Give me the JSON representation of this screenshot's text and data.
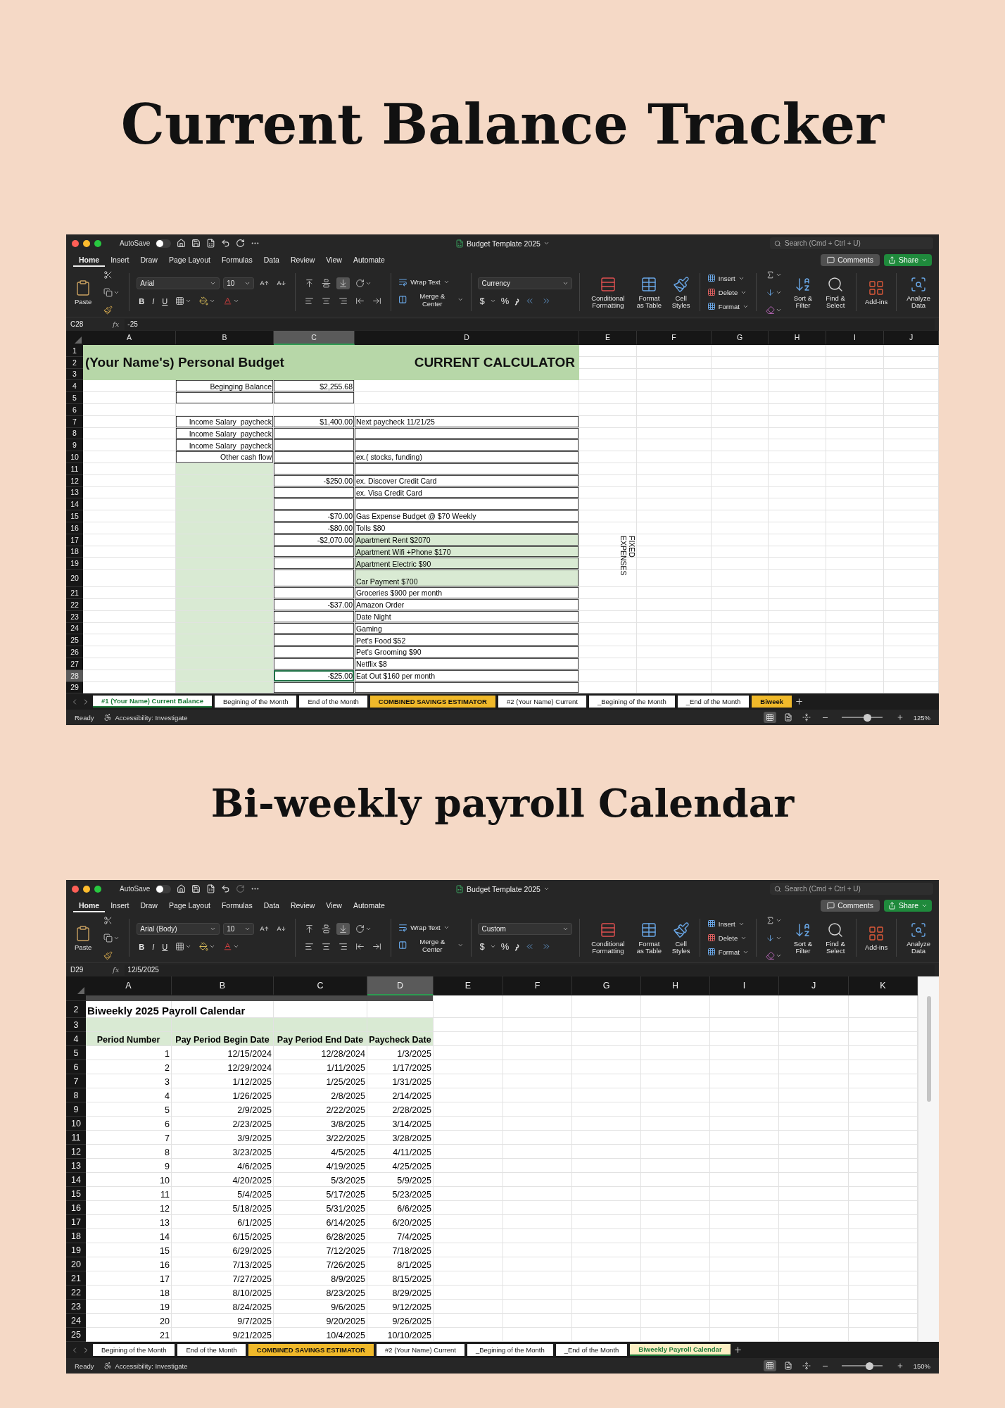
{
  "sections": [
    {
      "heading": "Current Balance Tracker",
      "window": {
        "title": "Budget Template 2025",
        "autosave": {
          "label": "AutoSave",
          "on": false
        },
        "redo": {
          "disabled": false
        },
        "search_placeholder": "Search (Cmd + Ctrl + U)",
        "menu_tabs": [
          {
            "label": "Home",
            "selected": true
          },
          {
            "label": "Insert",
            "selected": false
          },
          {
            "label": "Draw",
            "selected": false
          },
          {
            "label": "Page Layout",
            "selected": false
          },
          {
            "label": "Formulas",
            "selected": false
          },
          {
            "label": "Data",
            "selected": false
          },
          {
            "label": "Review",
            "selected": false
          },
          {
            "label": "View",
            "selected": false
          },
          {
            "label": "Automate",
            "selected": false
          }
        ],
        "comments": "Comments",
        "share": "Share",
        "ribbon": {
          "paste": "Paste",
          "font": "Arial",
          "font_size": "10",
          "bold": "B",
          "italic": "I",
          "underline": "U",
          "vertical_align": [
            {
              "kind": "top",
              "selected": false
            },
            {
              "kind": "middle",
              "selected": false
            },
            {
              "kind": "bottom",
              "selected": true
            }
          ],
          "wrap_text": "Wrap Text",
          "merge": "Merge & Center",
          "number_format": "Currency",
          "currency": "$",
          "percent": "%",
          "conditional_formatting": "Conditional Formatting",
          "format_as_table": "Format as Table",
          "cell_styles": "Cell Styles",
          "insert": "Insert",
          "delete": "Delete",
          "format": "Format",
          "sort_filter": "Sort & Filter",
          "find_select": "Find & Select",
          "add_ins": "Add-ins",
          "analyze_data": "Analyze Data"
        },
        "formula_bar": {
          "name_box": "C28",
          "fx": "fx",
          "formula": "-25"
        },
        "sheet": {
          "hidden_first_row": false,
          "banner": {
            "left": "(Your Name's) Personal Budget",
            "right": "CURRENT CALCULATOR"
          },
          "columns": [
            {
              "label": "A",
              "selected": false
            },
            {
              "label": "B",
              "selected": false
            },
            {
              "label": "C",
              "selected": true
            },
            {
              "label": "D",
              "selected": false
            },
            {
              "label": "E",
              "selected": false
            },
            {
              "label": "F",
              "selected": false
            },
            {
              "label": "G",
              "selected": false
            },
            {
              "label": "H",
              "selected": false
            },
            {
              "label": "I",
              "selected": false
            },
            {
              "label": "J",
              "selected": false
            }
          ],
          "rows": [
            {
              "number": "1",
              "selected": false,
              "cells": {}
            },
            {
              "number": "2",
              "selected": false,
              "cells": {}
            },
            {
              "number": "3",
              "selected": false,
              "cells": {}
            },
            {
              "number": "4",
              "selected": false,
              "cells": {
                "B": "Beginging Balance",
                "C": "$2,255.68"
              }
            },
            {
              "number": "5",
              "selected": false,
              "cells": {}
            },
            {
              "number": "6",
              "selected": false,
              "cells": {}
            },
            {
              "number": "7",
              "selected": false,
              "cells": {
                "B": "Income Salary  paycheck",
                "C": "$1,400.00",
                "D": "Next paycheck 11/21/25"
              }
            },
            {
              "number": "8",
              "selected": false,
              "cells": {
                "B": "Income Salary  paycheck"
              }
            },
            {
              "number": "9",
              "selected": false,
              "cells": {
                "B": "Income Salary  paycheck"
              }
            },
            {
              "number": "10",
              "selected": false,
              "cells": {
                "B": "Other cash flow",
                "D": "ex.( stocks, funding)"
              }
            },
            {
              "number": "11",
              "selected": false,
              "cells": {}
            },
            {
              "number": "12",
              "selected": false,
              "cells": {
                "C": "-$250.00",
                "D": "ex. Discover Credit Card"
              }
            },
            {
              "number": "13",
              "selected": false,
              "cells": {
                "D": "ex. Visa Credit Card"
              }
            },
            {
              "number": "14",
              "selected": false,
              "cells": {}
            },
            {
              "number": "15",
              "selected": false,
              "cells": {
                "C": "-$70.00",
                "D": "Gas Expense Budget @ $70 Weekly"
              }
            },
            {
              "number": "16",
              "selected": false,
              "cells": {
                "C": "-$80.00",
                "D": "Tolls $80"
              }
            },
            {
              "number": "17",
              "selected": false,
              "cells": {
                "C": "-$2,070.00",
                "D": "Apartment Rent $2070",
                "E": "FIXED EXPENSES"
              }
            },
            {
              "number": "18",
              "selected": false,
              "cells": {
                "D": "Apartment Wifi +Phone $170"
              }
            },
            {
              "number": "19",
              "selected": false,
              "cells": {
                "D": "Apartment Electric $90"
              }
            },
            {
              "number": "20",
              "selected": false,
              "cells": {
                "D": "Car Payment $700"
              }
            },
            {
              "number": "21",
              "selected": false,
              "cells": {
                "D": "Groceries $900 per month"
              }
            },
            {
              "number": "22",
              "selected": false,
              "cells": {
                "C": "-$37.00",
                "D": "Amazon Order"
              }
            },
            {
              "number": "23",
              "selected": false,
              "cells": {
                "D": "Date Night"
              }
            },
            {
              "number": "24",
              "selected": false,
              "cells": {
                "D": "Gaming"
              }
            },
            {
              "number": "25",
              "selected": false,
              "cells": {
                "D": "Pet's Food $52"
              }
            },
            {
              "number": "26",
              "selected": false,
              "cells": {
                "D": "Pet's Grooming $90"
              }
            },
            {
              "number": "27",
              "selected": false,
              "cells": {
                "D": "Netflix $8"
              }
            },
            {
              "number": "28",
              "selected": true,
              "cells": {
                "C": "-$25.00",
                "D": "Eat Out $160 per month"
              }
            },
            {
              "number": "29",
              "selected": false,
              "cells": {}
            }
          ]
        },
        "sheet_tabs": [
          {
            "label": "#1 (Your Name) Current Balance",
            "selected": true,
            "color": "#ffffff"
          },
          {
            "label": "Begining of the Month",
            "selected": false,
            "color": "#ffffff"
          },
          {
            "label": "End of the Month",
            "selected": false,
            "color": "#ffffff"
          },
          {
            "label": "COMBINED SAVINGS ESTIMATOR",
            "selected": false,
            "color": "#f0b92a"
          },
          {
            "label": "#2 (Your Name) Current",
            "selected": false,
            "color": "#ffffff"
          },
          {
            "label": "_Begining of the Month",
            "selected": false,
            "color": "#ffffff"
          },
          {
            "label": "_End of the Month",
            "selected": false,
            "color": "#ffffff"
          },
          {
            "label": "Biweek",
            "selected": false,
            "color": "#f0b92a"
          }
        ],
        "status_bar": {
          "ready": "Ready",
          "accessibility": "Accessibility: Investigate",
          "views": [
            {
              "kind": "normal",
              "selected": true
            },
            {
              "kind": "page_layout",
              "selected": false
            },
            {
              "kind": "page_break",
              "selected": false
            }
          ],
          "zoom_slider": {
            "level": 0.6
          },
          "zoom": "125%"
        }
      }
    },
    {
      "heading": "Bi-weekly payroll Calendar",
      "window": {
        "title": "Budget Template 2025",
        "autosave": {
          "label": "AutoSave",
          "on": false
        },
        "redo": {
          "disabled": true
        },
        "search_placeholder": "Search (Cmd + Ctrl + U)",
        "menu_tabs": [
          {
            "label": "Home",
            "selected": true
          },
          {
            "label": "Insert",
            "selected": false
          },
          {
            "label": "Draw",
            "selected": false
          },
          {
            "label": "Page Layout",
            "selected": false
          },
          {
            "label": "Formulas",
            "selected": false
          },
          {
            "label": "Data",
            "selected": false
          },
          {
            "label": "Review",
            "selected": false
          },
          {
            "label": "View",
            "selected": false
          },
          {
            "label": "Automate",
            "selected": false
          }
        ],
        "comments": "Comments",
        "share": "Share",
        "ribbon": {
          "paste": "Paste",
          "font": "Arial (Body)",
          "font_size": "10",
          "bold": "B",
          "italic": "I",
          "underline": "U",
          "vertical_align": [
            {
              "kind": "top",
              "selected": false
            },
            {
              "kind": "middle",
              "selected": false
            },
            {
              "kind": "bottom",
              "selected": true
            }
          ],
          "wrap_text": "Wrap Text",
          "merge": "Merge & Center",
          "number_format": "Custom",
          "currency": "$",
          "percent": "%",
          "conditional_formatting": "Conditional Formatting",
          "format_as_table": "Format as Table",
          "cell_styles": "Cell Styles",
          "insert": "Insert",
          "delete": "Delete",
          "format": "Format",
          "sort_filter": "Sort & Filter",
          "find_select": "Find & Select",
          "add_ins": "Add-ins",
          "analyze_data": "Analyze Data"
        },
        "formula_bar": {
          "name_box": "D29",
          "fx": "fx",
          "formula": "12/5/2025"
        },
        "sheet": {
          "hidden_first_row": true,
          "columns": [
            {
              "label": "A",
              "selected": false
            },
            {
              "label": "B",
              "selected": false
            },
            {
              "label": "C",
              "selected": false
            },
            {
              "label": "D",
              "selected": true
            },
            {
              "label": "E",
              "selected": false
            },
            {
              "label": "F",
              "selected": false
            },
            {
              "label": "G",
              "selected": false
            },
            {
              "label": "H",
              "selected": false
            },
            {
              "label": "I",
              "selected": false
            },
            {
              "label": "J",
              "selected": false
            },
            {
              "label": "K",
              "selected": false
            }
          ],
          "rows": [
            {
              "number": "2",
              "selected": false,
              "cells": {
                "A": "Biweekly 2025 Payroll Calendar"
              }
            },
            {
              "number": "3",
              "selected": false,
              "cells": {}
            },
            {
              "number": "4",
              "selected": false,
              "cells": {
                "A": "Period Number",
                "B": "Pay Period Begin Date",
                "C": "Pay Period End Date",
                "D": "Paycheck Date"
              }
            },
            {
              "number": "5",
              "selected": false,
              "cells": {
                "A": "1",
                "B": "12/15/2024",
                "C": "12/28/2024",
                "D": "1/3/2025"
              }
            },
            {
              "number": "6",
              "selected": false,
              "cells": {
                "A": "2",
                "B": "12/29/2024",
                "C": "1/11/2025",
                "D": "1/17/2025"
              }
            },
            {
              "number": "7",
              "selected": false,
              "cells": {
                "A": "3",
                "B": "1/12/2025",
                "C": "1/25/2025",
                "D": "1/31/2025"
              }
            },
            {
              "number": "8",
              "selected": false,
              "cells": {
                "A": "4",
                "B": "1/26/2025",
                "C": "2/8/2025",
                "D": "2/14/2025"
              }
            },
            {
              "number": "9",
              "selected": false,
              "cells": {
                "A": "5",
                "B": "2/9/2025",
                "C": "2/22/2025",
                "D": "2/28/2025"
              }
            },
            {
              "number": "10",
              "selected": false,
              "cells": {
                "A": "6",
                "B": "2/23/2025",
                "C": "3/8/2025",
                "D": "3/14/2025"
              }
            },
            {
              "number": "11",
              "selected": false,
              "cells": {
                "A": "7",
                "B": "3/9/2025",
                "C": "3/22/2025",
                "D": "3/28/2025"
              }
            },
            {
              "number": "12",
              "selected": false,
              "cells": {
                "A": "8",
                "B": "3/23/2025",
                "C": "4/5/2025",
                "D": "4/11/2025"
              }
            },
            {
              "number": "13",
              "selected": false,
              "cells": {
                "A": "9",
                "B": "4/6/2025",
                "C": "4/19/2025",
                "D": "4/25/2025"
              }
            },
            {
              "number": "14",
              "selected": false,
              "cells": {
                "A": "10",
                "B": "4/20/2025",
                "C": "5/3/2025",
                "D": "5/9/2025"
              }
            },
            {
              "number": "15",
              "selected": false,
              "cells": {
                "A": "11",
                "B": "5/4/2025",
                "C": "5/17/2025",
                "D": "5/23/2025"
              }
            },
            {
              "number": "16",
              "selected": false,
              "cells": {
                "A": "12",
                "B": "5/18/2025",
                "C": "5/31/2025",
                "D": "6/6/2025"
              }
            },
            {
              "number": "17",
              "selected": false,
              "cells": {
                "A": "13",
                "B": "6/1/2025",
                "C": "6/14/2025",
                "D": "6/20/2025"
              }
            },
            {
              "number": "18",
              "selected": false,
              "cells": {
                "A": "14",
                "B": "6/15/2025",
                "C": "6/28/2025",
                "D": "7/4/2025"
              }
            },
            {
              "number": "19",
              "selected": false,
              "cells": {
                "A": "15",
                "B": "6/29/2025",
                "C": "7/12/2025",
                "D": "7/18/2025"
              }
            },
            {
              "number": "20",
              "selected": false,
              "cells": {
                "A": "16",
                "B": "7/13/2025",
                "C": "7/26/2025",
                "D": "8/1/2025"
              }
            },
            {
              "number": "21",
              "selected": false,
              "cells": {
                "A": "17",
                "B": "7/27/2025",
                "C": "8/9/2025",
                "D": "8/15/2025"
              }
            },
            {
              "number": "22",
              "selected": false,
              "cells": {
                "A": "18",
                "B": "8/10/2025",
                "C": "8/23/2025",
                "D": "8/29/2025"
              }
            },
            {
              "number": "23",
              "selected": false,
              "cells": {
                "A": "19",
                "B": "8/24/2025",
                "C": "9/6/2025",
                "D": "9/12/2025"
              }
            },
            {
              "number": "24",
              "selected": false,
              "cells": {
                "A": "20",
                "B": "9/7/2025",
                "C": "9/20/2025",
                "D": "9/26/2025"
              }
            },
            {
              "number": "25",
              "selected": false,
              "cells": {
                "A": "21",
                "B": "9/21/2025",
                "C": "10/4/2025",
                "D": "10/10/2025"
              }
            }
          ]
        },
        "sheet_tabs": [
          {
            "label": "Begining of the Month",
            "selected": false,
            "color": "#ffffff"
          },
          {
            "label": "End of the Month",
            "selected": false,
            "color": "#ffffff"
          },
          {
            "label": "COMBINED SAVINGS ESTIMATOR",
            "selected": false,
            "color": "#f0b92a"
          },
          {
            "label": "#2 (Your Name) Current",
            "selected": false,
            "color": "#ffffff"
          },
          {
            "label": "_Begining of the Month",
            "selected": false,
            "color": "#ffffff"
          },
          {
            "label": "_End of the Month",
            "selected": false,
            "color": "#ffffff"
          },
          {
            "label": "Biweekly Payroll Calendar",
            "selected": true,
            "color": "#fcefc4"
          }
        ],
        "status_bar": {
          "ready": "Ready",
          "accessibility": "Accessibility: Investigate",
          "views": [
            {
              "kind": "normal",
              "selected": true
            },
            {
              "kind": "page_layout",
              "selected": false
            },
            {
              "kind": "page_break",
              "selected": false
            }
          ],
          "zoom_slider": {
            "level": 0.65
          },
          "zoom": "150%"
        }
      }
    }
  ]
}
